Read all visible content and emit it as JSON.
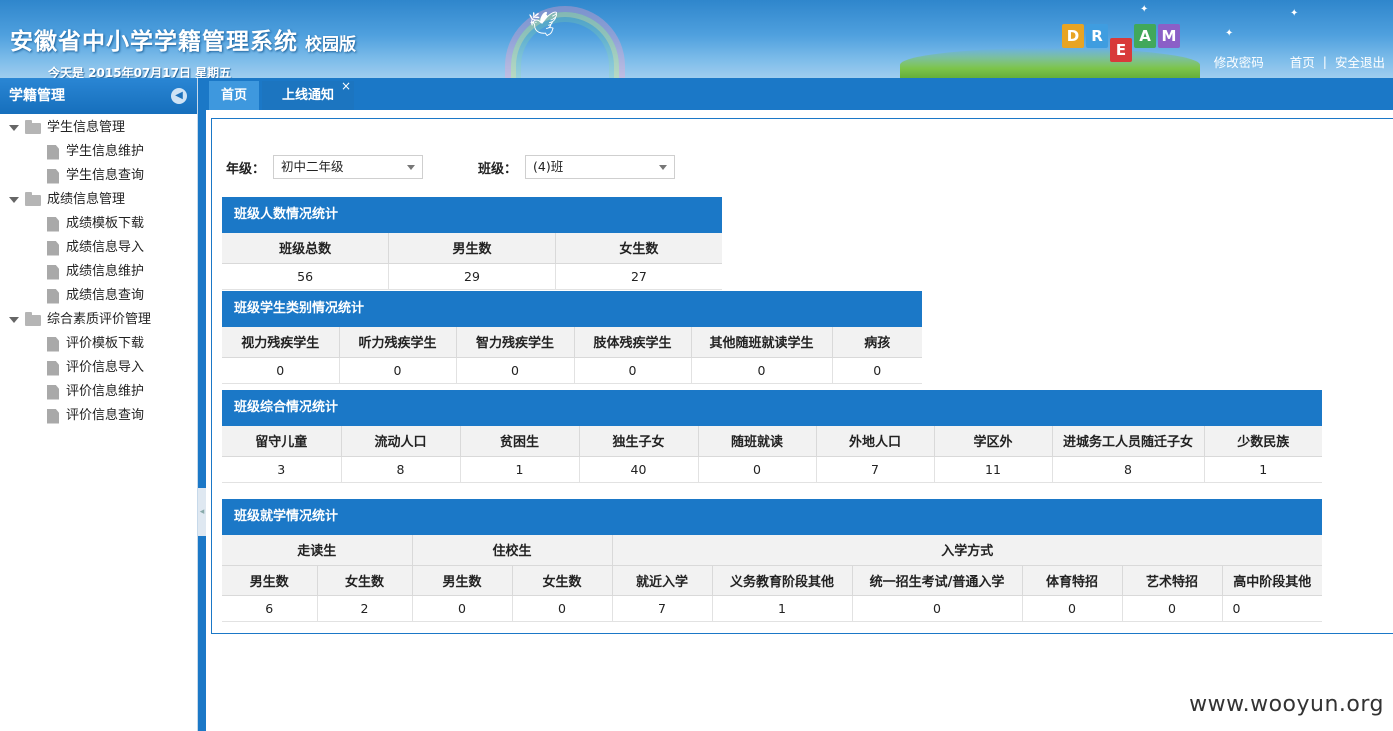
{
  "header": {
    "title": "安徽省中小学学籍管理系统",
    "subtitle": "校园版",
    "date": "今天是 2015年07月17日 星期五",
    "dream_letters": [
      "D",
      "R",
      "E",
      "A",
      "M"
    ],
    "links": {
      "change_password": "修改密码",
      "home": "首页",
      "separator": "|",
      "logout": "安全退出"
    }
  },
  "sidebar": {
    "title": "学籍管理",
    "groups": [
      {
        "label": "学生信息管理",
        "items": [
          "学生信息维护",
          "学生信息查询"
        ]
      },
      {
        "label": "成绩信息管理",
        "items": [
          "成绩模板下载",
          "成绩信息导入",
          "成绩信息维护",
          "成绩信息查询"
        ]
      },
      {
        "label": "综合素质评价管理",
        "items": [
          "评价模板下载",
          "评价信息导入",
          "评价信息维护",
          "评价信息查询"
        ]
      }
    ]
  },
  "tabs": [
    {
      "label": "首页",
      "active": true
    },
    {
      "label": "上线通知",
      "close": "×"
    }
  ],
  "filters": {
    "grade_label": "年级：",
    "grade_value": "初中二年级",
    "class_label": "班级：",
    "class_value": "(4)班"
  },
  "sections": {
    "count": {
      "title": "班级人数情况统计",
      "headers": [
        "班级总数",
        "男生数",
        "女生数"
      ],
      "values": [
        "56",
        "29",
        "27"
      ]
    },
    "category": {
      "title": "班级学生类别情况统计",
      "headers": [
        "视力残疾学生",
        "听力残疾学生",
        "智力残疾学生",
        "肢体残疾学生",
        "其他随班就读学生",
        "病孩"
      ],
      "values": [
        "0",
        "0",
        "0",
        "0",
        "0",
        "0"
      ]
    },
    "overall": {
      "title": "班级综合情况统计",
      "headers": [
        "留守儿童",
        "流动人口",
        "贫困生",
        "独生子女",
        "随班就读",
        "外地人口",
        "学区外",
        "进城务工人员随迁子女",
        "少数民族"
      ],
      "values": [
        "3",
        "8",
        "1",
        "40",
        "0",
        "7",
        "11",
        "8",
        "1"
      ]
    },
    "enroll": {
      "title": "班级就学情况统计",
      "group_headers": [
        "走读生",
        "住校生",
        "入学方式"
      ],
      "headers": [
        "男生数",
        "女生数",
        "男生数",
        "女生数",
        "就近入学",
        "义务教育阶段其他",
        "统一招生考试/普通入学",
        "体育特招",
        "艺术特招",
        "高中阶段其他"
      ],
      "values": [
        "6",
        "2",
        "0",
        "0",
        "7",
        "1",
        "0",
        "0",
        "0",
        "0"
      ]
    }
  },
  "watermark": "www.wooyun.org"
}
